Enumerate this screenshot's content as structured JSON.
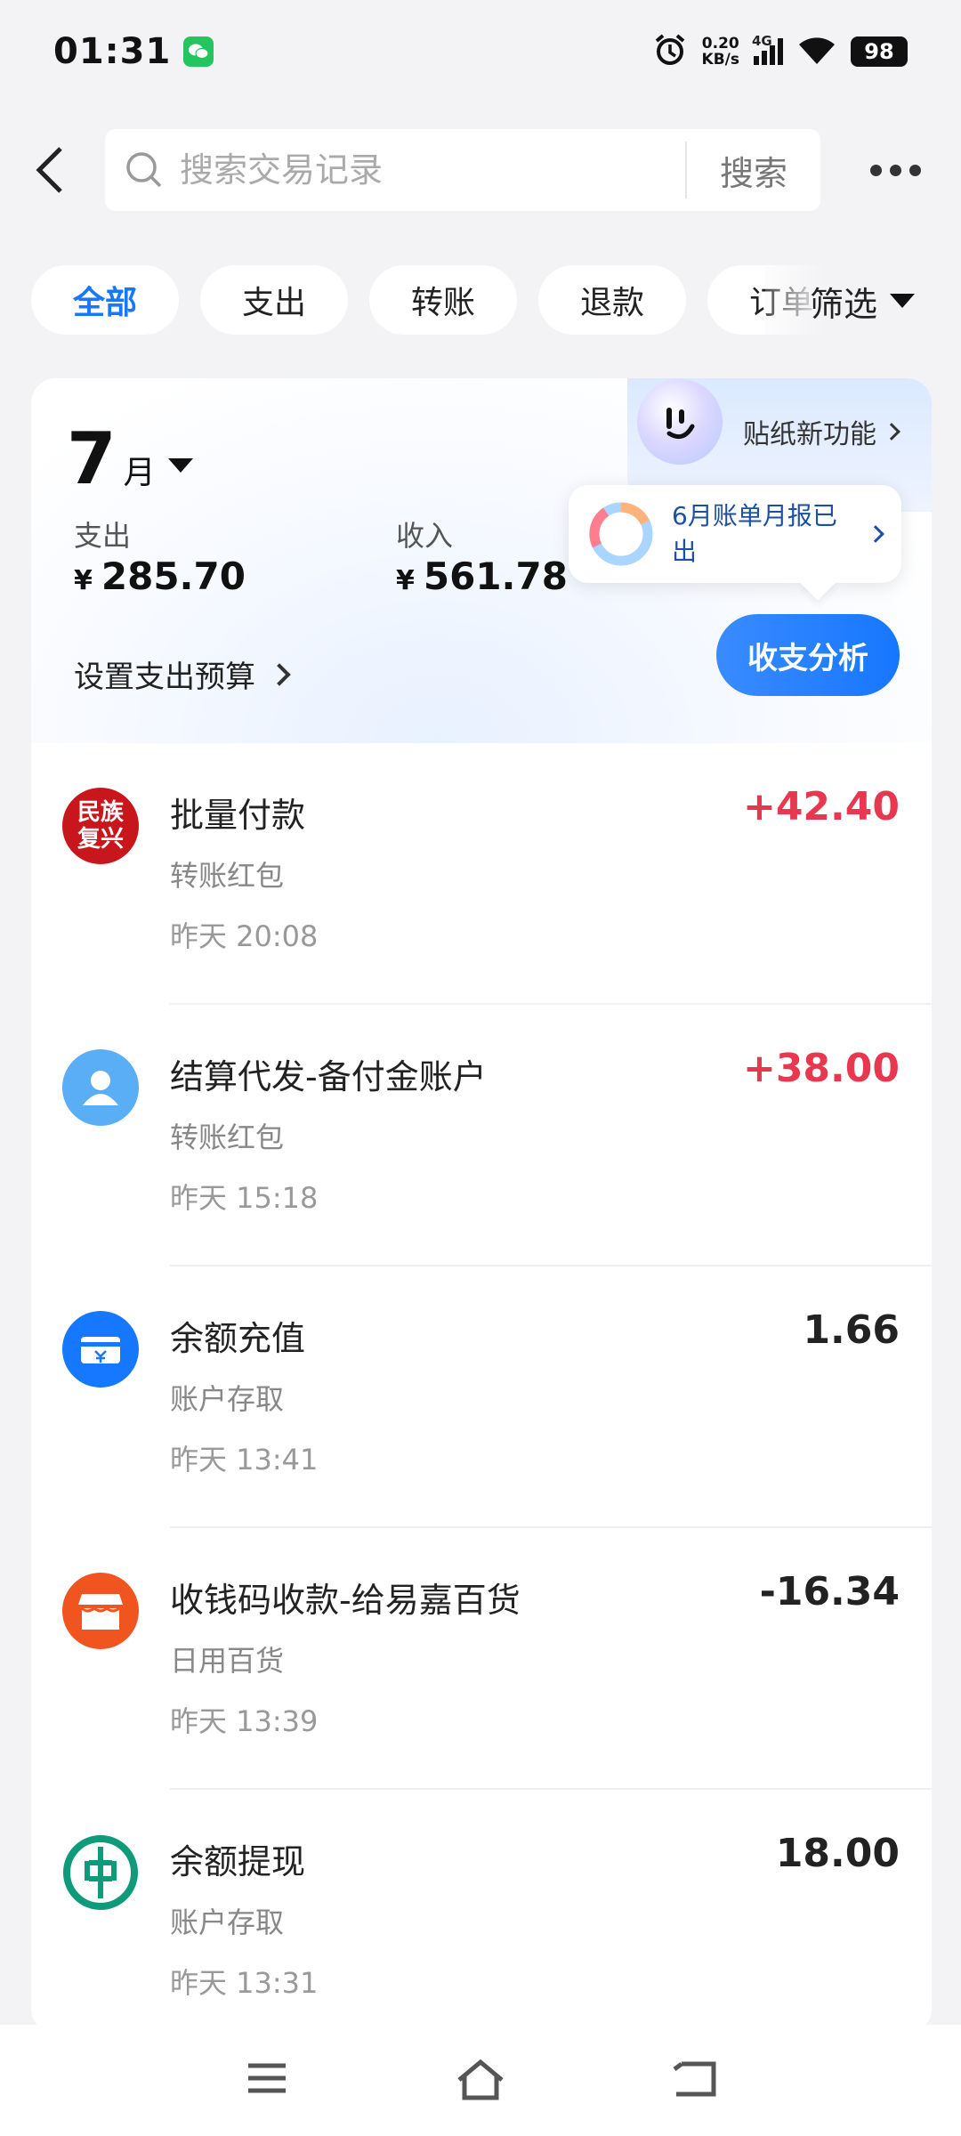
{
  "status": {
    "time": "01:31",
    "net_speed_value": "0.20",
    "net_speed_unit": "KB/s",
    "network": "4G",
    "battery": "98"
  },
  "header": {
    "search_placeholder": "搜索交易记录",
    "search_button": "搜索"
  },
  "filters": {
    "chips": [
      "全部",
      "支出",
      "转账",
      "退款",
      "订单"
    ],
    "filter_label": "筛选"
  },
  "summary": {
    "month_num": "7",
    "month_unit": "月",
    "expense_label": "支出",
    "expense_value": "285.70",
    "income_label": "收入",
    "income_value": "561.78",
    "currency": "¥",
    "budget_label": "设置支出预算",
    "sticker_label": "贴纸新功能",
    "report_text": "6月账单月报已出",
    "analysis_button": "收支分析"
  },
  "transactions": [
    {
      "title": "批量付款",
      "category": "转账红包",
      "time": "昨天 20:08",
      "amount": "+42.40",
      "positive": true,
      "icon": "bank-seal-icon",
      "icon_text": "民族复兴",
      "color": "#c8161d"
    },
    {
      "title": "结算代发-备付金账户",
      "category": "转账红包",
      "time": "昨天 15:18",
      "amount": "+38.00",
      "positive": true,
      "icon": "person-icon",
      "color": "#5aaef5"
    },
    {
      "title": "余额充值",
      "category": "账户存取",
      "time": "昨天 13:41",
      "amount": "1.66",
      "positive": false,
      "icon": "wallet-card-icon",
      "color": "#1677ff"
    },
    {
      "title": "收钱码收款-给易嘉百货",
      "category": "日用百货",
      "time": "昨天 13:39",
      "amount": "-16.34",
      "positive": false,
      "icon": "store-icon",
      "color": "#f0541f"
    },
    {
      "title": "余额提现",
      "category": "账户存取",
      "time": "昨天 13:31",
      "amount": "18.00",
      "positive": false,
      "icon": "abc-bank-icon",
      "color": "#0f9a7a"
    }
  ],
  "colors": {
    "accent": "#1677ff",
    "positive_amount": "#e8384f"
  }
}
